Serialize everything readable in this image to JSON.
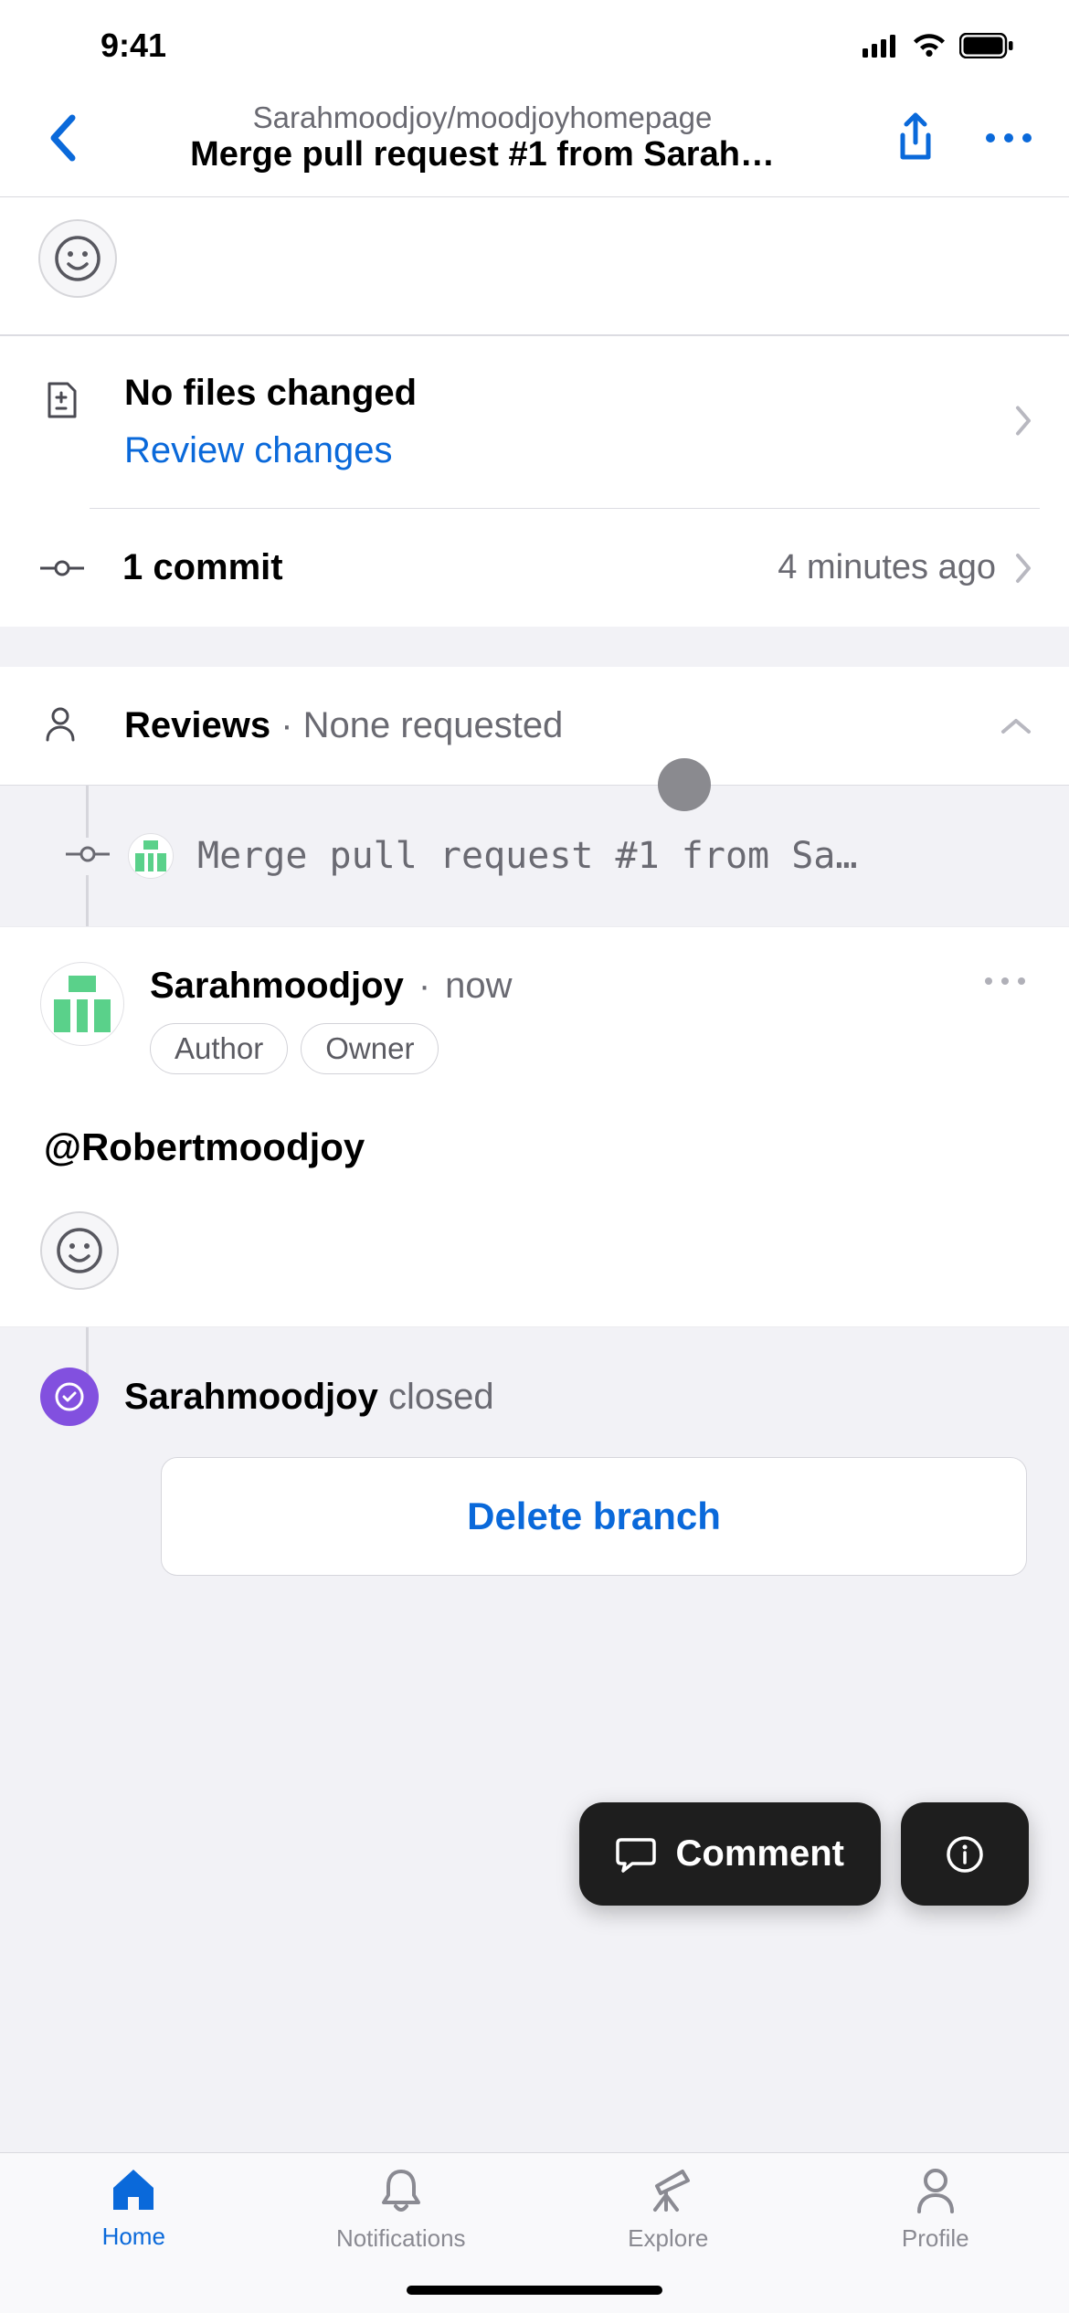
{
  "status": {
    "time": "9:41"
  },
  "header": {
    "repo_path": "Sarahmoodjoy/moodjoyhomepage",
    "title": "Merge pull request #1 from Sarah…"
  },
  "files": {
    "title": "No files changed",
    "review_link": "Review changes"
  },
  "commits": {
    "label": "1 commit",
    "time": "4 minutes ago"
  },
  "reviews": {
    "label": "Reviews",
    "status": "None requested"
  },
  "merge_event": {
    "message": "Merge pull request #1 from Sa…"
  },
  "comment": {
    "user": "Sarahmoodjoy",
    "time": "now",
    "badges": [
      "Author",
      "Owner"
    ],
    "body": "@Robertmoodjoy"
  },
  "closed_event": {
    "user": "Sarahmoodjoy",
    "action": "closed",
    "delete_label": "Delete branch"
  },
  "fab": {
    "comment": "Comment"
  },
  "tabs": {
    "home": "Home",
    "notifications": "Notifications",
    "explore": "Explore",
    "profile": "Profile"
  }
}
